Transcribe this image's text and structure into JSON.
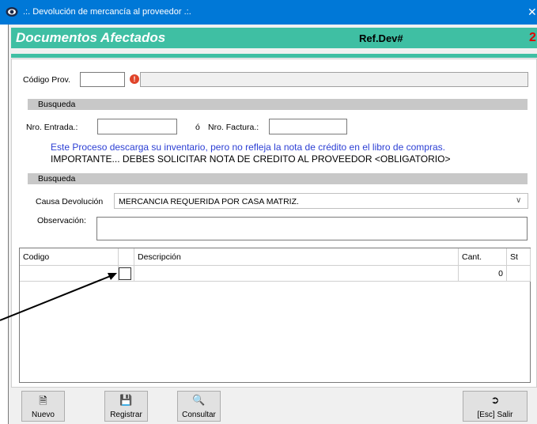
{
  "window": {
    "title": ".:. Devolución de mercancía al proveedor .:.",
    "close_glyph": "✕"
  },
  "header": {
    "title": "Documentos Afectados",
    "ref_label": "Ref.Dev#",
    "ref_number": "2",
    "accent_color": "#3fbfa3"
  },
  "provider": {
    "label": "Código Prov.",
    "value": "",
    "info_icon": "!",
    "name_value": ""
  },
  "search_section": {
    "title": "Busqueda",
    "entrada_label": "Nro. Entrada.:",
    "entrada_value": "",
    "or_label": "ó",
    "factura_label": "Nro. Factura.:",
    "factura_value": ""
  },
  "messages": {
    "info": "Este Proceso descarga su inventario, pero no refleja la nota de crédito en el libro de compras.",
    "warning": "IMPORTANTE... DEBES SOLICITAR NOTA DE CREDITO AL PROVEEDOR <OBLIGATORIO>"
  },
  "reason_section": {
    "title": "Busqueda",
    "causa_label": "Causa Devolución",
    "causa_value": "MERCANCIA REQUERIDA POR CASA MATRIZ.",
    "observacion_label": "Observación:",
    "observacion_value": ""
  },
  "grid": {
    "columns": [
      "Codigo",
      "",
      "Descripción",
      "Cant.",
      "St"
    ],
    "rows": [
      {
        "codigo": "",
        "descripcion": "",
        "cant": "0",
        "st": ""
      }
    ]
  },
  "toolbar": {
    "nuevo": "Nuevo",
    "registrar": "Registrar",
    "consultar": "Consultar",
    "salir": "[Esc] Salir"
  }
}
